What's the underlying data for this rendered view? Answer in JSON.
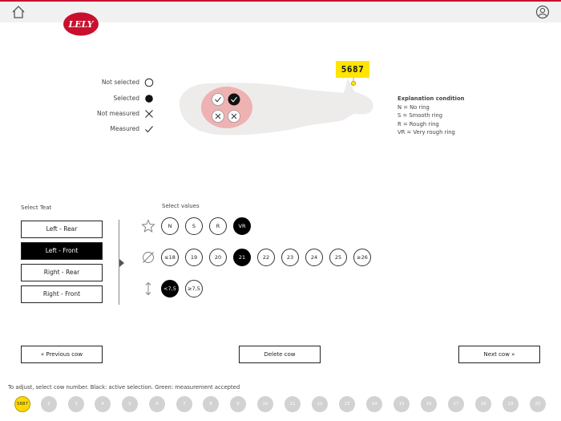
{
  "header": {
    "logo_text": "LELY",
    "colors": {
      "accent": "#c8102e",
      "tag": "#ffe500",
      "bar": "#f1f1f1"
    }
  },
  "legend": {
    "items": [
      {
        "label": "Not selected",
        "icon": "empty-circle-icon"
      },
      {
        "label": "Selected",
        "icon": "filled-circle-icon"
      },
      {
        "label": "Not measured",
        "icon": "cross-icon"
      },
      {
        "label": "Measured",
        "icon": "check-icon"
      }
    ]
  },
  "cow_tag": "5687",
  "explanation": {
    "title": "Explanation condition",
    "lines": [
      "N = No ring",
      "S = Smooth ring",
      "R = Rough ring",
      "VR = Very rough ring"
    ]
  },
  "teat_panel": {
    "label": "Select Teat",
    "buttons": [
      "Left - Rear",
      "Left - Front",
      "Right - Rear",
      "Right - Front"
    ],
    "active_index": 1
  },
  "values_panel": {
    "label": "Select values",
    "condition": {
      "options": [
        "N",
        "S",
        "R",
        "VR"
      ],
      "selected": "VR"
    },
    "diameter": {
      "options": [
        "≤18",
        "19",
        "20",
        "21",
        "22",
        "23",
        "24",
        "25",
        "≥26"
      ],
      "selected": "21"
    },
    "length": {
      "options": [
        "<7,5",
        "≥7,5"
      ],
      "selected": "<7,5"
    }
  },
  "nav": {
    "previous": "« Previous cow",
    "delete": "Delete cow",
    "next": "Next cow »"
  },
  "hint": "To adjust, select cow number. Black: active selection. Green: measurement accepted",
  "cows": [
    "5687",
    "2",
    "3",
    "4",
    "5",
    "6",
    "7",
    "8",
    "9",
    "10",
    "11",
    "12",
    "13",
    "14",
    "15",
    "16",
    "17",
    "18",
    "19",
    "20"
  ],
  "active_cow_index": 0
}
